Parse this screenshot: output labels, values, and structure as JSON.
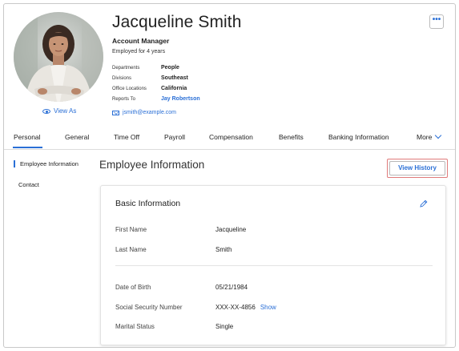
{
  "profile": {
    "name": "Jacqueline Smith",
    "title": "Account Manager",
    "employed": "Employed for 4 years",
    "view_as": "View As",
    "email": "jsmith@example.com",
    "facts": [
      {
        "label": "Departments",
        "value": "People"
      },
      {
        "label": "Divisions",
        "value": "Southeast"
      },
      {
        "label": "Office Locations",
        "value": "California"
      },
      {
        "label": "Reports To",
        "value": "Jay Robertson"
      }
    ],
    "more_button": "•••"
  },
  "tabs": [
    {
      "label": "Personal",
      "active": true
    },
    {
      "label": "General"
    },
    {
      "label": "Time Off"
    },
    {
      "label": "Payroll"
    },
    {
      "label": "Compensation"
    },
    {
      "label": "Benefits"
    },
    {
      "label": "Banking Information"
    },
    {
      "label": "More"
    }
  ],
  "sidebar": {
    "items": [
      {
        "label": "Employee Information",
        "active": true
      },
      {
        "label": "Contact"
      }
    ]
  },
  "main": {
    "section_title": "Employee Information",
    "view_history": "View History",
    "card": {
      "title": "Basic Information",
      "fields": [
        {
          "label": "First Name",
          "value": "Jacqueline"
        },
        {
          "label": "Last Name",
          "value": "Smith"
        },
        {
          "label": "Date of Birth",
          "value": "05/21/1984"
        },
        {
          "label": "Social Security Number",
          "value": "XXX-XX-4856",
          "action": "Show"
        },
        {
          "label": "Marital Status",
          "value": "Single"
        }
      ]
    }
  },
  "colors": {
    "accent": "#2a6fd6",
    "highlight_box": "#e07b7b"
  },
  "icons": [
    "eye-icon",
    "envelope-icon",
    "more-dots-icon",
    "chevron-down-icon",
    "pencil-icon"
  ]
}
